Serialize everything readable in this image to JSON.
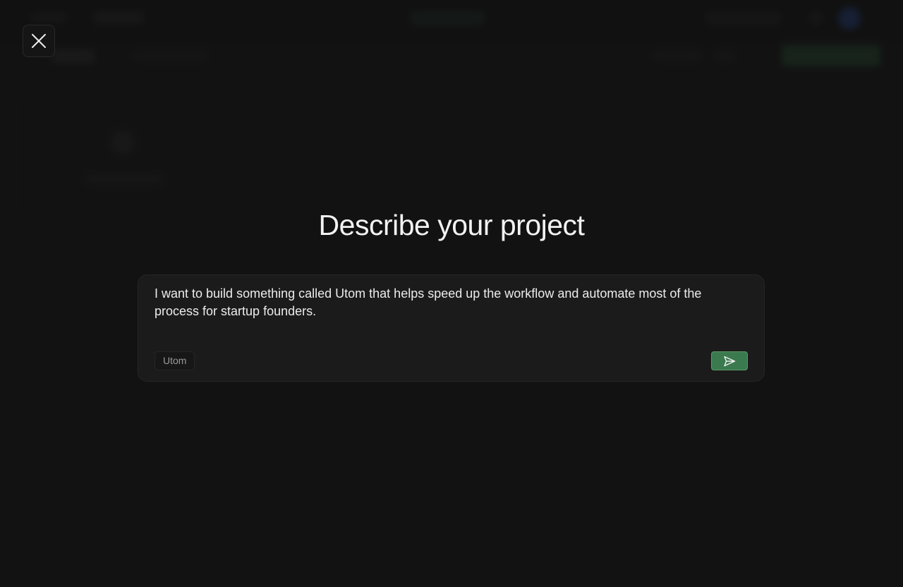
{
  "modal": {
    "title": "Describe your project",
    "prompt_value": "I want to build something called Utom that helps speed up the workflow and automate most of the process for startup founders.",
    "tag_label": "Utom"
  },
  "icons": {
    "close": "close-icon",
    "send": "send-icon"
  },
  "colors": {
    "accent": "#3a7a4e",
    "background": "#121212",
    "card": "#1b1b1b"
  }
}
